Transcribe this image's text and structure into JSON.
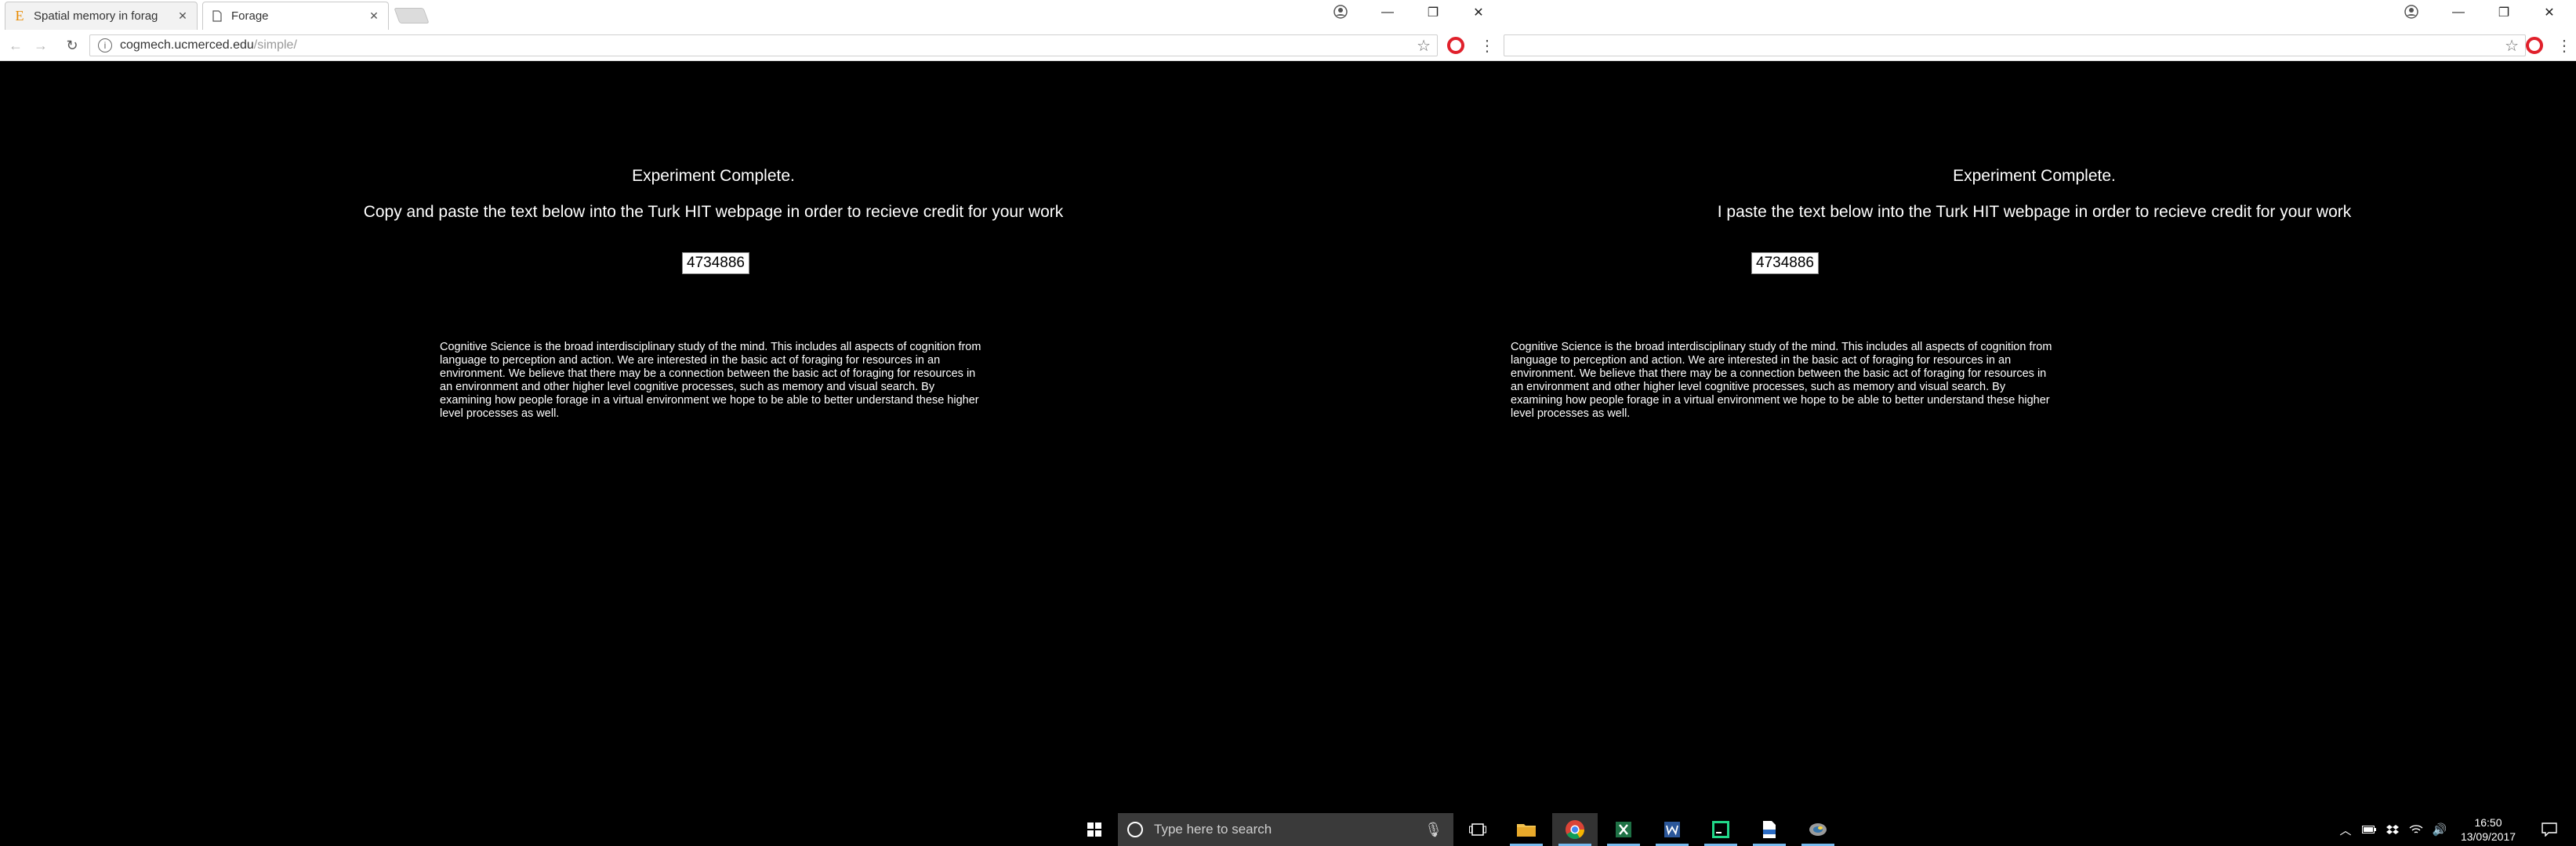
{
  "left_window": {
    "tabs": [
      {
        "title": "Spatial memory in forag",
        "favicon": "E"
      },
      {
        "title": "Forage",
        "favicon": "page-icon"
      }
    ],
    "url_host": "cogmech.ucmerced.edu",
    "url_path": "/simple/",
    "page": {
      "heading": "Experiment Complete.",
      "instruction": "Copy and paste the text below into the Turk HIT webpage in order to recieve credit for your work",
      "code": "4734886",
      "blurb": "Cognitive Science is the broad interdisciplinary study of the mind. This includes all aspects of cognition from language to perception and action. We are interested in the basic act of foraging for resources in an environment. We believe that there may be a connection between the basic act of foraging for resources in an environment and other higher level cognitive processes, such as memory and visual search. By examining how people forage in a virtual environment we hope to be able to better understand these higher level processes as well."
    }
  },
  "right_window": {
    "url_host": "",
    "page": {
      "heading": "Experiment Complete.",
      "instruction": "I paste the text below into the Turk HIT webpage in order to recieve credit for your work",
      "code": "4734886",
      "blurb": "Cognitive Science is the broad interdisciplinary study of the mind. This includes all aspects of cognition from language to perception and action. We are interested in the basic act of foraging for resources in an environment. We believe that there may be a connection between the basic act of foraging for resources in an environment and other higher level cognitive processes, such as memory and visual search. By examining how people forage in a virtual environment we hope to be able to better understand these higher level processes as well."
    }
  },
  "taskbar": {
    "search_placeholder": "Type here to search",
    "time": "16:50",
    "date": "13/09/2017",
    "apps": [
      "file-explorer-icon",
      "chrome-icon",
      "excel-icon",
      "word-icon",
      "pycharm-icon",
      "document-icon",
      "python-icon"
    ]
  },
  "colors": {
    "page_background": "#000000",
    "text": "#ffffff",
    "opera_red": "#e0202b",
    "taskbar_accent": "#76b9ed"
  }
}
